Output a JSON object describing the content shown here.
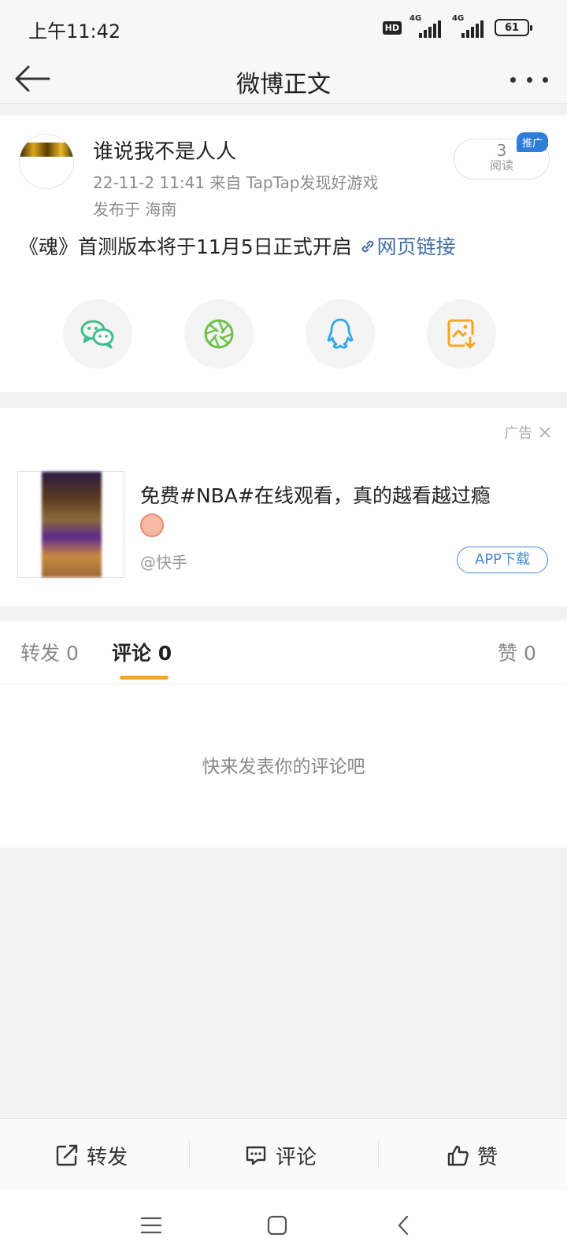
{
  "status_bar": {
    "time": "上午11:42",
    "hd": "HD",
    "network_1": "4G",
    "network_2": "4G",
    "battery": "61"
  },
  "nav": {
    "title": "微博正文"
  },
  "post": {
    "author": "谁说我不是人人",
    "meta": "22-11-2 11:41  来自 TapTap发现好游戏",
    "location": "发布于 海南",
    "read_count": "3",
    "read_label": "阅读",
    "promo_tag": "推广",
    "text": "《魂》首测版本将于11月5日正式开启",
    "link_text": "网页链接"
  },
  "share_buttons": [
    {
      "name": "wechat",
      "icon": "wechat-icon"
    },
    {
      "name": "moments",
      "icon": "moments-icon"
    },
    {
      "name": "qq",
      "icon": "qq-icon"
    },
    {
      "name": "save-image",
      "icon": "save-image-icon"
    }
  ],
  "ad": {
    "label": "广告",
    "title": "免费#NBA#在线观看，真的越看越过瘾",
    "source": "@快手",
    "download_label": "APP下载"
  },
  "tabs": {
    "repost": {
      "label": "转发",
      "count": "0"
    },
    "comment": {
      "label": "评论",
      "count": "0"
    },
    "like": {
      "label": "赞",
      "count": "0"
    }
  },
  "empty_comment": "快来发表你的评论吧",
  "bottom_actions": {
    "repost": "转发",
    "comment": "评论",
    "like": "赞"
  },
  "colors": {
    "accent_orange": "#f5a623",
    "link_blue": "#3f6ea6",
    "promo_blue": "#2f7ed8"
  }
}
